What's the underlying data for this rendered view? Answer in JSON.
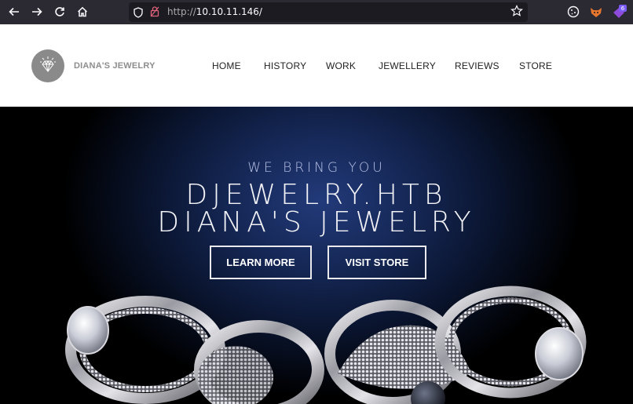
{
  "browser": {
    "url_protocol": "http://",
    "url_host": "10.10.11.146/",
    "extension_badge": "6"
  },
  "header": {
    "brand": "DIANA'S JEWELRY",
    "nav": [
      "HOME",
      "HISTORY",
      "WORK",
      "JEWELLERY",
      "REVIEWS",
      "STORE"
    ]
  },
  "hero": {
    "kicker": "WE BRING YOU",
    "title_line1": "DJEWELRY.HTB",
    "title_line2": "DIANA'S JEWELRY",
    "learn_more": "LEARN MORE",
    "visit_store": "VISIT STORE"
  },
  "colors": {
    "chrome_bg": "#2b2a33",
    "urlbar_bg": "#1c1b22",
    "hero_accent": "#223a7a",
    "logo_gray": "#8a8a8a"
  },
  "icons": [
    "back-arrow-icon",
    "forward-arrow-icon",
    "reload-icon",
    "home-icon",
    "shield-icon",
    "lock-icon",
    "star-icon",
    "extension-icons"
  ]
}
